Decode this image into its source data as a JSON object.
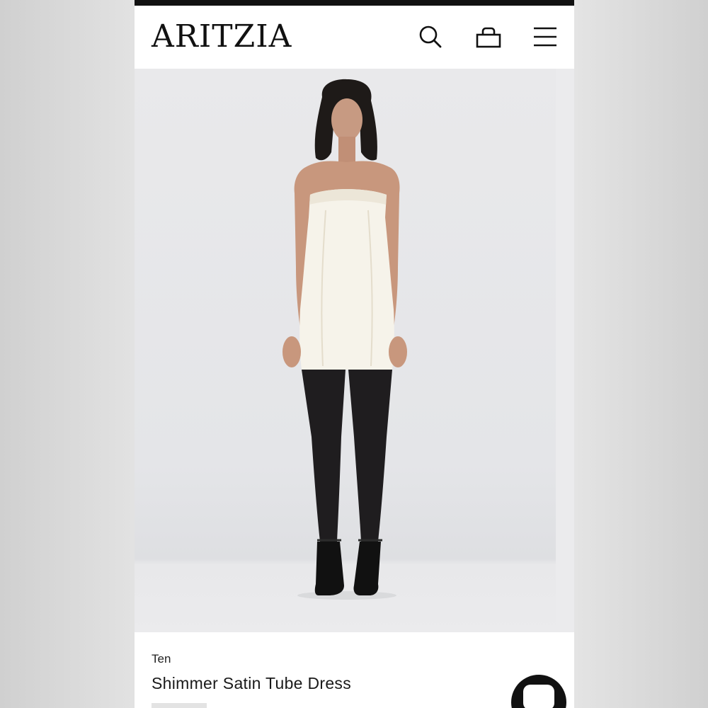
{
  "header": {
    "logo_text": "ARITZIA",
    "icons": [
      "search-icon",
      "shopping-bag-icon",
      "menu-icon"
    ]
  },
  "hero": {
    "image_subject": "model-in-white-strapless-mini-dress"
  },
  "product": {
    "brand": "Ten",
    "name": "Shimmer Satin Tube Dress"
  },
  "colors": {
    "top_strip": "#111111",
    "header_bg": "#ffffff",
    "text": "#111111",
    "hero_bg": "#e7e7e9",
    "chat_button": "#111111"
  }
}
